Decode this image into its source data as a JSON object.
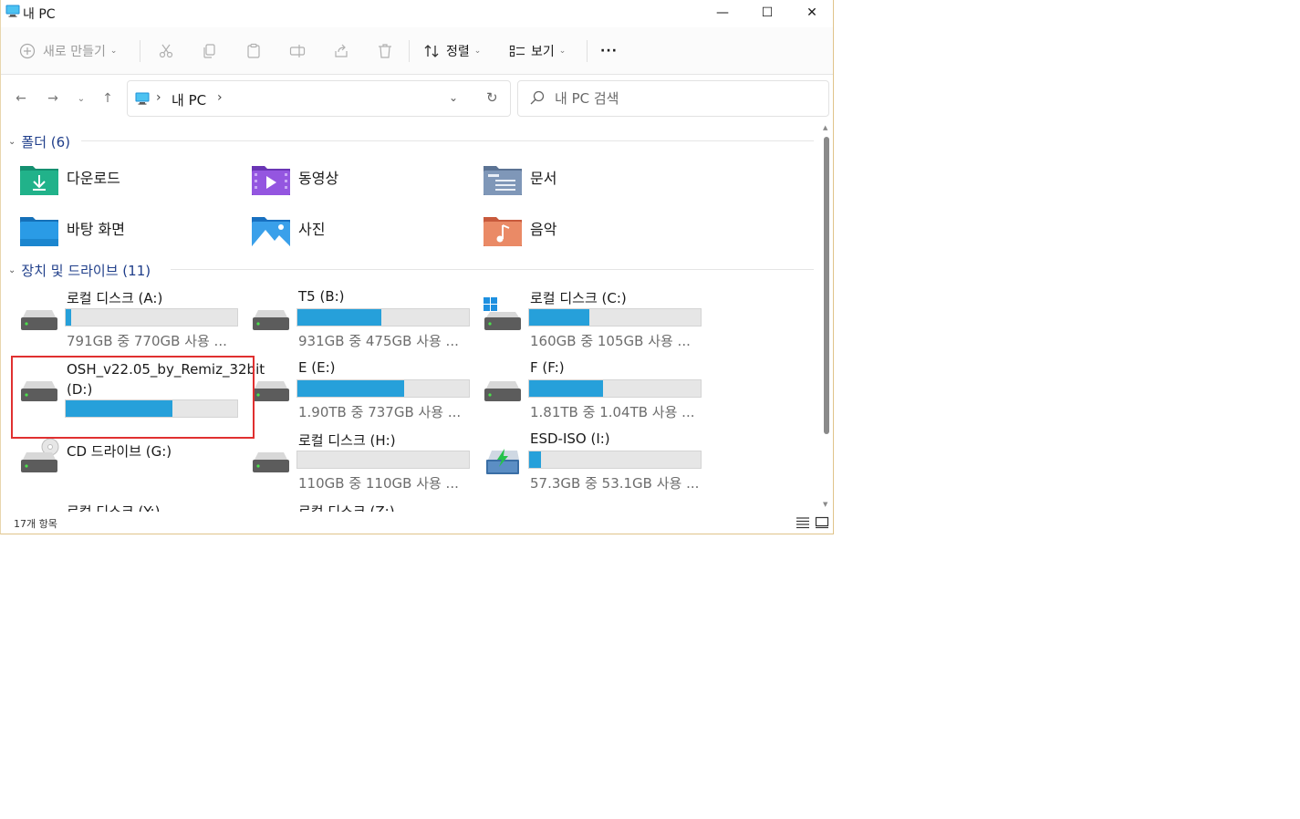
{
  "window": {
    "title": "내 PC",
    "controls": {
      "minimize": "—",
      "maximize": "☐",
      "close": "✕"
    }
  },
  "commandbar": {
    "new_label": "새로 만들기",
    "sort_label": "정렬",
    "view_label": "보기",
    "more_label": "···"
  },
  "address": {
    "crumb": "내 PC",
    "search_placeholder": "내 PC 검색"
  },
  "folders_section": {
    "title": "폴더 (6)",
    "items": [
      {
        "name": "다운로드",
        "icon": "downloads-folder-icon",
        "color": "#1fa37a"
      },
      {
        "name": "동영상",
        "icon": "videos-folder-icon",
        "color": "#8a4fd6"
      },
      {
        "name": "문서",
        "icon": "documents-folder-icon",
        "color": "#6c86a8"
      },
      {
        "name": "바탕 화면",
        "icon": "desktop-folder-icon",
        "color": "#1e88d4"
      },
      {
        "name": "사진",
        "icon": "pictures-folder-icon",
        "color": "#2a8fd8"
      },
      {
        "name": "음악",
        "icon": "music-folder-icon",
        "color": "#e07a5a"
      }
    ]
  },
  "drives_section": {
    "title": "장치 및 드라이브 (11)",
    "items": [
      {
        "name": "로컬 디스크 (A:)",
        "info": "791GB 중 770GB 사용 ...",
        "used_fraction": 0.03
      },
      {
        "name": "T5 (B:)",
        "info": "931GB 중 475GB 사용 ...",
        "used_fraction": 0.49
      },
      {
        "name": "로컬 디스크 (C:)",
        "info": "160GB 중 105GB 사용 ...",
        "used_fraction": 0.35
      },
      {
        "name": "OSH_v22.05_by_Remiz_32bit (D:)",
        "info": "",
        "used_fraction": 0.62
      },
      {
        "name": "E (E:)",
        "info": "1.90TB 중 737GB 사용 ...",
        "used_fraction": 0.62
      },
      {
        "name": "F (F:)",
        "info": "1.81TB 중 1.04TB 사용 ...",
        "used_fraction": 0.43
      },
      {
        "name": "CD 드라이브 (G:)",
        "info": "",
        "used_fraction": null
      },
      {
        "name": "로컬 디스크 (H:)",
        "info": "110GB 중 110GB 사용 ...",
        "used_fraction": 0.0
      },
      {
        "name": "ESD-ISO (I:)",
        "info": "57.3GB 중 53.1GB 사용 ...",
        "used_fraction": 0.07
      },
      {
        "name": "로컬 디스크 (Y:)",
        "info": "",
        "used_fraction": null
      },
      {
        "name": "로컬 디스크 (Z:)",
        "info": "",
        "used_fraction": null
      }
    ]
  },
  "status": {
    "count": "17개 항목"
  },
  "colors": {
    "accent": "#26a0da",
    "section_header": "#1f3e8a",
    "highlight": "#e03030"
  }
}
